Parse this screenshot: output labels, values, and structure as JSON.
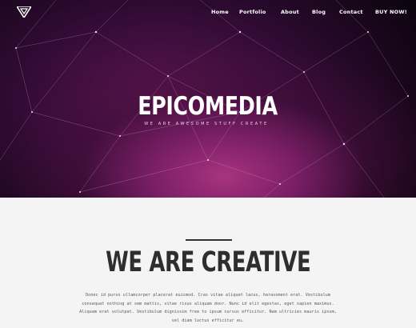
{
  "nav": {
    "items": [
      "Home",
      "Portfolio",
      "About",
      "Blog",
      "Contact",
      "BUY NOW!"
    ]
  },
  "hero": {
    "title": "EPICOMEDIA",
    "tagline": "WE ARE AWESOME STUFF CREATE"
  },
  "section": {
    "heading": "WE ARE CREATIVE",
    "paragraph": "Donec id purus ullamcorper placerat euismod. Cras vitae aliquet lacus, harassment erat. Vestibulum consequat nothing at sem mattis, vitae risus aliquam door. Nunc id elit egestas, eget sapien maximus. Aliquam erat volutpat. Vestibulum dignissim free to ipsum cursus efficitur. Nam ultricies mauris ipsum, vel diam luctus efficitur eu."
  },
  "colors": {
    "hero_dark": "#0e0410",
    "hero_magenta": "#a8337e",
    "section_bg": "#f4f4f4",
    "heading": "#2e2e2e"
  },
  "icons": {
    "logo": "v-logo-icon"
  }
}
